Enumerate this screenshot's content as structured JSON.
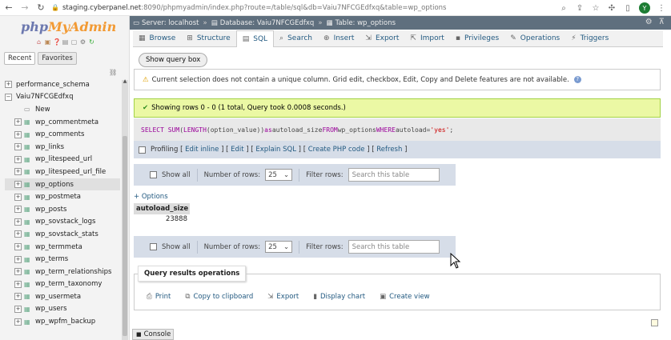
{
  "browser": {
    "url_host": "staging.cyberpanel.net",
    "url_rest": ":8090/phpmyadmin/index.php?route=/table/sql&db=Vaiu7NFCGEdfxq&table=wp_options",
    "avatar_letter": "Y"
  },
  "sidebar": {
    "logo_php": "php",
    "logo_myadmin": "MyAdmin",
    "tabs": [
      "Recent",
      "Favorites"
    ],
    "tree": [
      {
        "label": "performance_schema",
        "kind": "db",
        "level": 0
      },
      {
        "label": "Vaiu7NFCGEdfxq",
        "kind": "db",
        "level": 0
      },
      {
        "label": "New",
        "kind": "new",
        "level": 1
      },
      {
        "label": "wp_commentmeta",
        "kind": "table",
        "level": 1
      },
      {
        "label": "wp_comments",
        "kind": "table",
        "level": 1
      },
      {
        "label": "wp_links",
        "kind": "table",
        "level": 1
      },
      {
        "label": "wp_litespeed_url",
        "kind": "table",
        "level": 1
      },
      {
        "label": "wp_litespeed_url_file",
        "kind": "table",
        "level": 1
      },
      {
        "label": "wp_options",
        "kind": "table",
        "level": 1,
        "selected": true
      },
      {
        "label": "wp_postmeta",
        "kind": "table",
        "level": 1
      },
      {
        "label": "wp_posts",
        "kind": "table",
        "level": 1
      },
      {
        "label": "wp_sovstack_logs",
        "kind": "table",
        "level": 1
      },
      {
        "label": "wp_sovstack_stats",
        "kind": "table",
        "level": 1
      },
      {
        "label": "wp_termmeta",
        "kind": "table",
        "level": 1
      },
      {
        "label": "wp_terms",
        "kind": "table",
        "level": 1
      },
      {
        "label": "wp_term_relationships",
        "kind": "table",
        "level": 1
      },
      {
        "label": "wp_term_taxonomy",
        "kind": "table",
        "level": 1
      },
      {
        "label": "wp_usermeta",
        "kind": "table",
        "level": 1
      },
      {
        "label": "wp_users",
        "kind": "table",
        "level": 1
      },
      {
        "label": "wp_wpfm_backup",
        "kind": "table",
        "level": 1
      }
    ]
  },
  "breadcrumb": {
    "server": "Server: localhost",
    "database": "Database: Vaiu7NFCGEdfxq",
    "table": "Table: wp_options"
  },
  "menu": [
    {
      "label": "Browse",
      "icon": "browse-icon"
    },
    {
      "label": "Structure",
      "icon": "structure-icon"
    },
    {
      "label": "SQL",
      "icon": "sql-icon",
      "active": true
    },
    {
      "label": "Search",
      "icon": "search-icon"
    },
    {
      "label": "Insert",
      "icon": "insert-icon"
    },
    {
      "label": "Export",
      "icon": "export-icon"
    },
    {
      "label": "Import",
      "icon": "import-icon"
    },
    {
      "label": "Privileges",
      "icon": "privileges-icon"
    },
    {
      "label": "Operations",
      "icon": "operations-icon"
    },
    {
      "label": "Triggers",
      "icon": "triggers-icon"
    }
  ],
  "show_query_box": "Show query box",
  "notice": "Current selection does not contain a unique column. Grid edit, checkbox, Edit, Copy and Delete features are not available.",
  "success": "Showing rows 0 - 0 (1 total, Query took 0.0008 seconds.)",
  "sql": {
    "p1": "SELECT",
    "p2": "SUM",
    "p3": "(",
    "p4": "LENGTH",
    "p5": "(option_value)) ",
    "p6": "as",
    "p7": " autoload_size ",
    "p8": "FROM",
    "p9": " wp_options ",
    "p10": "WHERE",
    "p11": " autoload=",
    "p12": "'yes'",
    "p13": ";"
  },
  "sql_options": {
    "profiling": "Profiling",
    "lb": "[",
    "sep": "] [",
    "rb": "]",
    "edit_inline": "Edit inline",
    "edit": "Edit",
    "explain": "Explain SQL",
    "php": "Create PHP code",
    "refresh": "Refresh"
  },
  "navbar": {
    "show_all": "Show all",
    "number_of_rows": "Number of rows:",
    "rows_value": "25",
    "filter_rows": "Filter rows:",
    "filter_placeholder": "Search this table"
  },
  "options_link": "+ Options",
  "result": {
    "column": "autoload_size",
    "value": "23888"
  },
  "qro": {
    "legend": "Query results operations",
    "actions": [
      {
        "label": "Print",
        "icon": "print-icon"
      },
      {
        "label": "Copy to clipboard",
        "icon": "clipboard-icon"
      },
      {
        "label": "Export",
        "icon": "export-icon"
      },
      {
        "label": "Display chart",
        "icon": "chart-icon"
      },
      {
        "label": "Create view",
        "icon": "view-icon"
      }
    ]
  },
  "console": "Console"
}
